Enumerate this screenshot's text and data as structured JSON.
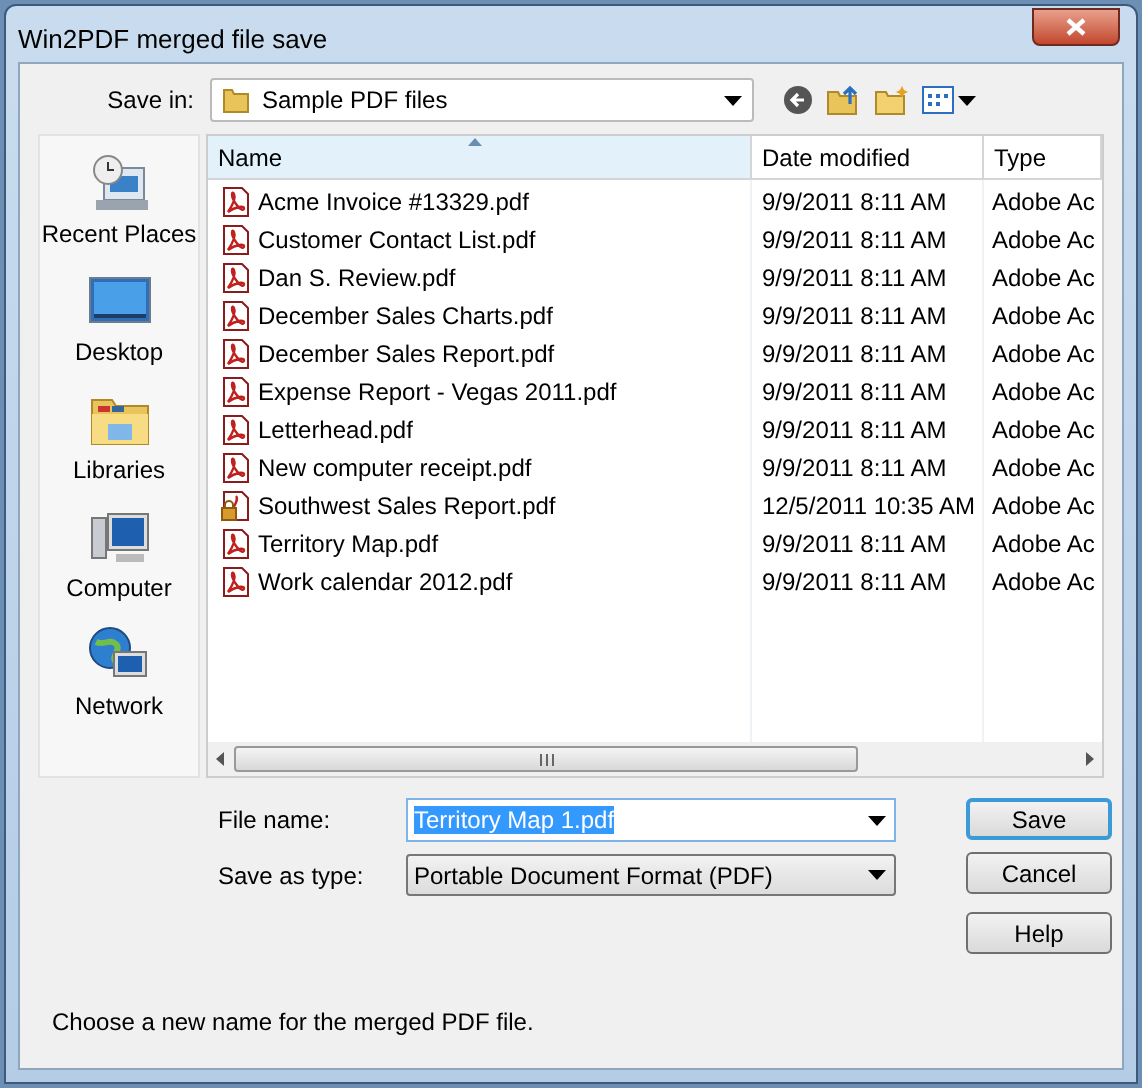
{
  "window": {
    "title": "Win2PDF merged file save"
  },
  "save_in": {
    "label": "Save in:",
    "value": "Sample PDF files"
  },
  "sidebar": {
    "items": [
      {
        "label": "Recent Places",
        "kind": "recent"
      },
      {
        "label": "Desktop",
        "kind": "desktop"
      },
      {
        "label": "Libraries",
        "kind": "libraries"
      },
      {
        "label": "Computer",
        "kind": "computer"
      },
      {
        "label": "Network",
        "kind": "network"
      }
    ]
  },
  "table": {
    "columns": [
      {
        "label": "Name",
        "sorted": true
      },
      {
        "label": "Date modified",
        "sorted": false
      },
      {
        "label": "Type",
        "sorted": false
      }
    ],
    "rows": [
      {
        "name": "Acme Invoice #13329.pdf",
        "date": "9/9/2011 8:11 AM",
        "type": "Adobe Ac",
        "kind": "pdf"
      },
      {
        "name": "Customer Contact List.pdf",
        "date": "9/9/2011 8:11 AM",
        "type": "Adobe Ac",
        "kind": "pdf"
      },
      {
        "name": "Dan S. Review.pdf",
        "date": "9/9/2011 8:11 AM",
        "type": "Adobe Ac",
        "kind": "pdf"
      },
      {
        "name": "December Sales Charts.pdf",
        "date": "9/9/2011 8:11 AM",
        "type": "Adobe Ac",
        "kind": "pdf"
      },
      {
        "name": "December Sales Report.pdf",
        "date": "9/9/2011 8:11 AM",
        "type": "Adobe Ac",
        "kind": "pdf"
      },
      {
        "name": "Expense Report - Vegas 2011.pdf",
        "date": "9/9/2011 8:11 AM",
        "type": "Adobe Ac",
        "kind": "pdf"
      },
      {
        "name": "Letterhead.pdf",
        "date": "9/9/2011 8:11 AM",
        "type": "Adobe Ac",
        "kind": "pdf"
      },
      {
        "name": "New computer receipt.pdf",
        "date": "9/9/2011 8:11 AM",
        "type": "Adobe Ac",
        "kind": "pdf"
      },
      {
        "name": "Southwest Sales Report.pdf",
        "date": "12/5/2011 10:35 AM",
        "type": "Adobe Ac",
        "kind": "locked"
      },
      {
        "name": "Territory Map.pdf",
        "date": "9/9/2011 8:11 AM",
        "type": "Adobe Ac",
        "kind": "pdf"
      },
      {
        "name": "Work calendar 2012.pdf",
        "date": "9/9/2011 8:11 AM",
        "type": "Adobe Ac",
        "kind": "pdf"
      }
    ]
  },
  "file_name": {
    "label": "File name:",
    "value": "Territory Map 1.pdf",
    "selected": true
  },
  "save_as_type": {
    "label": "Save as type:",
    "value": "Portable Document Format (PDF)"
  },
  "buttons": [
    {
      "label": "Save",
      "default": true
    },
    {
      "label": "Cancel",
      "default": false
    },
    {
      "label": "Help",
      "default": false
    }
  ],
  "message": "Choose a new name for the merged PDF file."
}
